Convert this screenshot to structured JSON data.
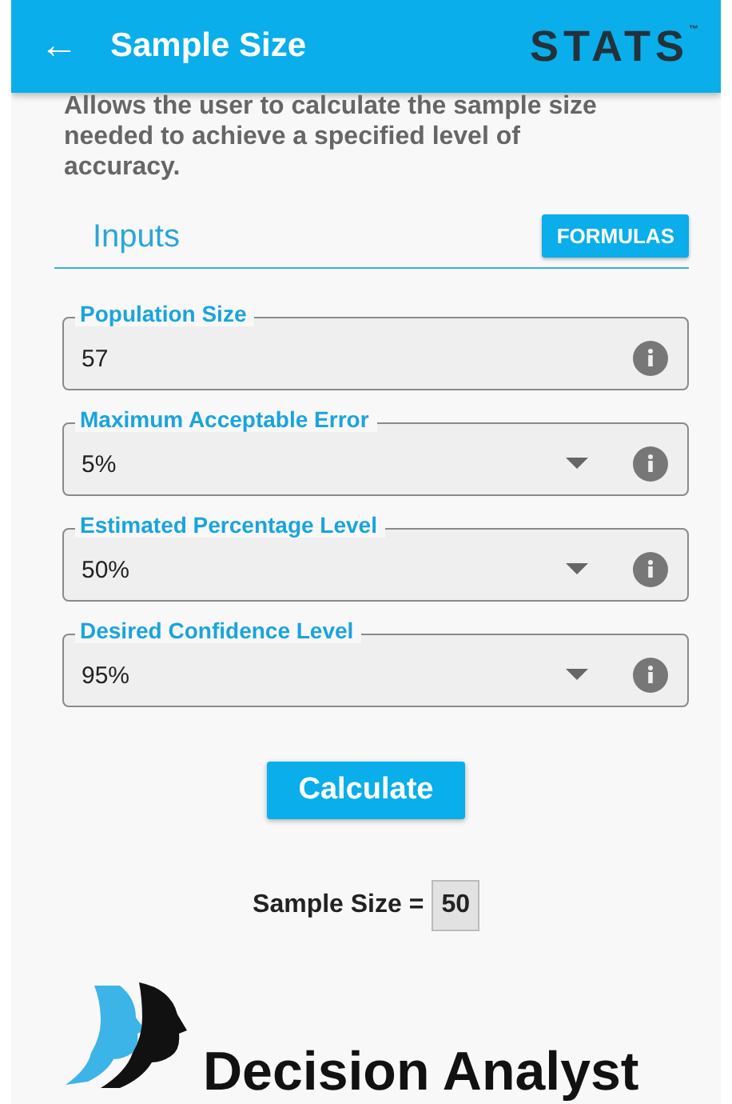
{
  "header": {
    "back": "←",
    "title": "Sample Size",
    "brand": "STATS",
    "brand_mark": "™"
  },
  "description": "Allows the user to calculate the sample size needed to achieve a specified level of accuracy.",
  "section": {
    "title": "Inputs",
    "button": "FORMULAS"
  },
  "fields": [
    {
      "kind": "text",
      "label": "Population Size",
      "value": "57"
    },
    {
      "kind": "dropdown",
      "label": "Maximum Acceptable Error",
      "value": "5%"
    },
    {
      "kind": "dropdown",
      "label": "Estimated Percentage Level",
      "value": "50%"
    },
    {
      "kind": "dropdown",
      "label": "Desired Confidence Level",
      "value": "95%"
    }
  ],
  "calculate": "Calculate",
  "result": {
    "label": "Sample Size =",
    "value": "50"
  },
  "footer_logo": "Decision Analyst"
}
